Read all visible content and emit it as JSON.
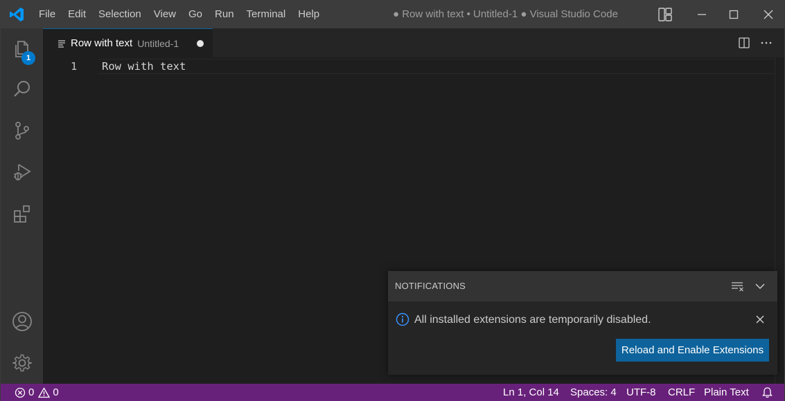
{
  "titlebar": {
    "menu": [
      "File",
      "Edit",
      "Selection",
      "View",
      "Go",
      "Run",
      "Terminal",
      "Help"
    ],
    "title": "● Row with text • Untitled-1 ● Visual Studio Code"
  },
  "activitybar": {
    "icons": [
      "explorer-icon",
      "search-icon",
      "source-control-icon",
      "run-debug-icon",
      "extensions-icon",
      "accounts-icon",
      "settings-gear-icon"
    ],
    "explorer_badge": "1"
  },
  "tab": {
    "name": "Row with text",
    "description": "Untitled-1",
    "dirty": true
  },
  "editor": {
    "lines": [
      {
        "number": "1",
        "text": "Row with text"
      }
    ]
  },
  "notifications": {
    "header": "NOTIFICATIONS",
    "message": "All installed extensions are temporarily disabled.",
    "action_label": "Reload and Enable Extensions"
  },
  "statusbar": {
    "errors": "0",
    "warnings": "0",
    "position": "Ln 1, Col 14",
    "spaces": "Spaces: 4",
    "encoding": "UTF-8",
    "eol": "CRLF",
    "language": "Plain Text"
  },
  "colors": {
    "statusbar": "#68217a",
    "accent": "#007acc",
    "button": "#0e639c"
  }
}
